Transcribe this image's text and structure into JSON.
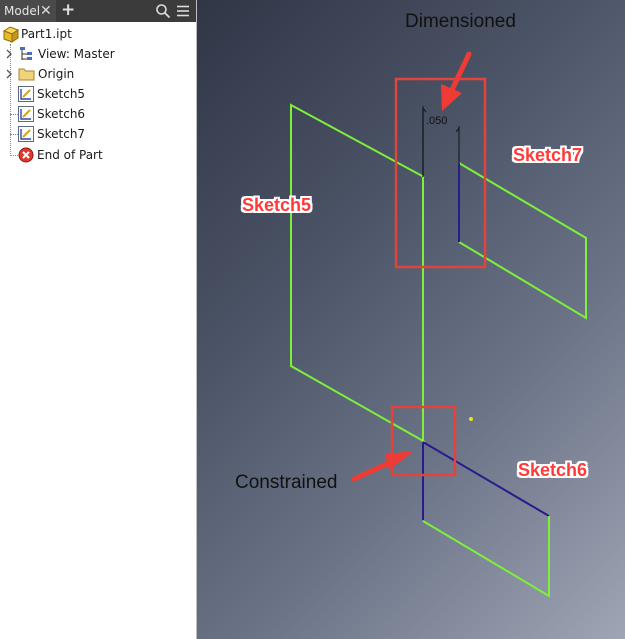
{
  "browser": {
    "tab_label": "Model",
    "close_glyph": "✕",
    "add_glyph": "+",
    "icons": {
      "search": "search-icon",
      "menu": "hamburger-menu-icon"
    },
    "tree": [
      {
        "label": "Part1.ipt",
        "icon": "part-icon"
      },
      {
        "label": "View: Master",
        "icon": "view-icon"
      },
      {
        "label": "Origin",
        "icon": "folder-icon"
      },
      {
        "label": "Sketch5",
        "icon": "sketch-icon"
      },
      {
        "label": "Sketch6",
        "icon": "sketch-icon"
      },
      {
        "label": "Sketch7",
        "icon": "sketch-icon"
      },
      {
        "label": "End of Part",
        "icon": "end-of-part-icon"
      }
    ]
  },
  "viewport": {
    "dimension_value": ".050",
    "annotations": {
      "dimensioned": "Dimensioned",
      "constrained": "Constrained"
    },
    "sketch_labels": {
      "sketch5": "Sketch5",
      "sketch6": "Sketch6",
      "sketch7": "Sketch7"
    },
    "colors": {
      "sketch_green": "#7cf03a",
      "sketch_purple": "#2a1a8c",
      "callout_red": "#ff3a3a",
      "highlight_red": "#e0443c"
    }
  }
}
